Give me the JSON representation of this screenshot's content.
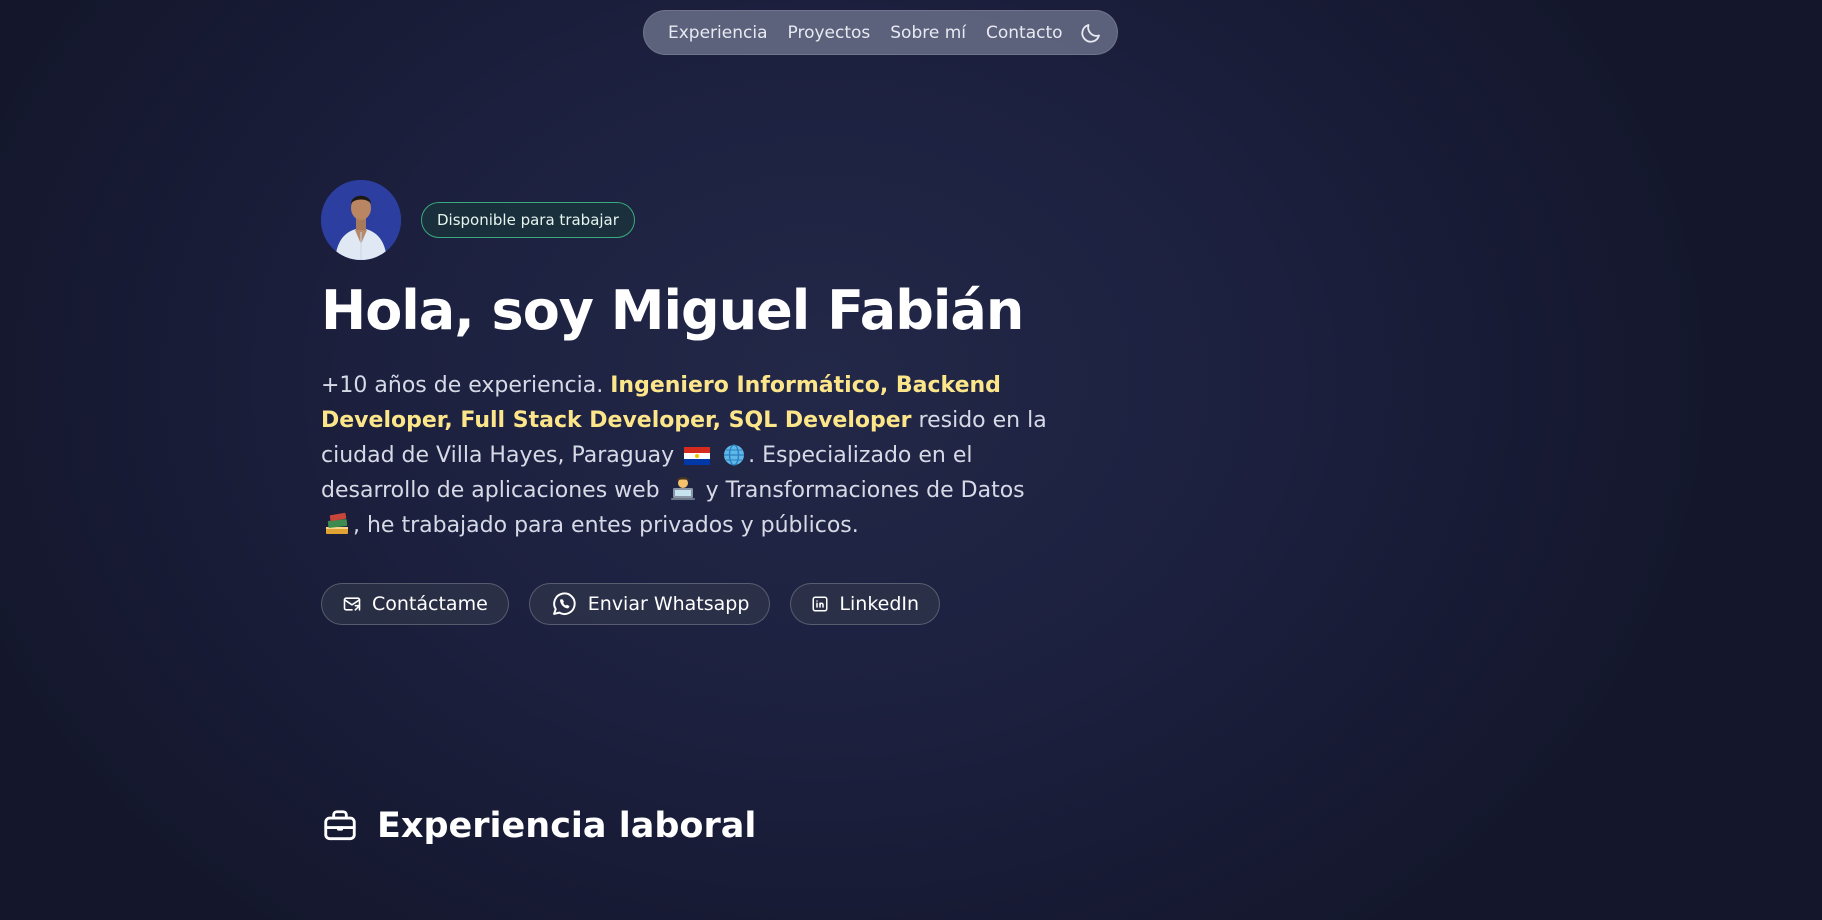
{
  "nav": {
    "items": [
      {
        "label": "Experiencia"
      },
      {
        "label": "Proyectos"
      },
      {
        "label": "Sobre mí"
      },
      {
        "label": "Contacto"
      }
    ],
    "theme_icon": "moon-icon"
  },
  "hero": {
    "badge": "Disponible para trabajar",
    "title": "Hola, soy Miguel Fabián",
    "intro": "+10 años de experiencia. ",
    "highlight": "Ingeniero Informático, Backend Developer, Full Stack Developer, SQL Developer",
    "text_1": " resido en la ciudad de Villa Hayes, Paraguay",
    "text_2": ". Especializado en el desarrollo de aplicaciones web",
    "text_3": " y Transformaciones de Datos",
    "text_4": ", he trabajado para entes privados y públicos.",
    "emojis": [
      "paraguay-flag-icon",
      "globe-icon",
      "technologist-icon",
      "books-icon"
    ]
  },
  "cta": [
    {
      "label": "Contáctame",
      "icon": "mail-icon"
    },
    {
      "label": "Enviar Whatsapp",
      "icon": "whatsapp-icon"
    },
    {
      "label": "LinkedIn",
      "icon": "linkedin-icon"
    }
  ],
  "sections": {
    "experience_title": "Experiencia laboral",
    "experience_icon": "briefcase-icon"
  },
  "colors": {
    "highlight": "#fde68a",
    "badge_border": "#3aa97e",
    "background": "#1d2140"
  }
}
